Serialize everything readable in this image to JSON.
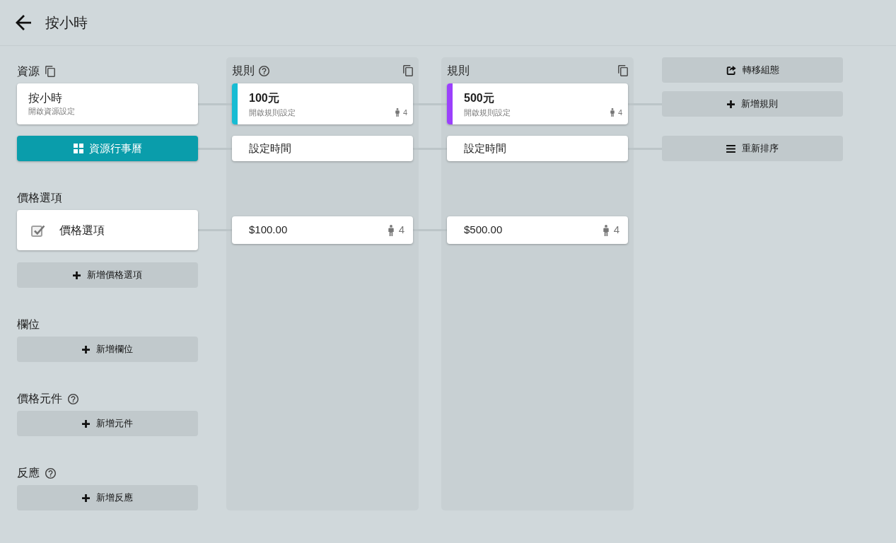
{
  "header": {
    "title": "按小時"
  },
  "resource": {
    "heading": "資源",
    "card": {
      "title": "按小時",
      "subtitle": "開啟資源設定"
    },
    "calendar_button": "資源行事曆"
  },
  "price_options": {
    "heading": "價格選項",
    "items": [
      {
        "label": "價格選項",
        "checked": true
      }
    ],
    "add_button": "新增價格選項"
  },
  "sections": [
    {
      "heading": "欄位",
      "help": false,
      "add_button": "新增欄位"
    },
    {
      "heading": "價格元件",
      "help": true,
      "add_button": "新增元件"
    },
    {
      "heading": "反應",
      "help": true,
      "add_button": "新增反應"
    }
  ],
  "rule_columns": [
    {
      "heading": "規則",
      "help": true,
      "color": "#18bcd3",
      "rule": {
        "title": "100元",
        "subtitle": "開啟規則設定",
        "count": "4"
      },
      "schedule": "設定時間",
      "price": {
        "amount": "$100.00",
        "count": "4"
      }
    },
    {
      "heading": "規則",
      "help": false,
      "color": "#9b40fc",
      "rule": {
        "title": "500元",
        "subtitle": "開啟規則設定",
        "count": "4"
      },
      "schedule": "設定時間",
      "price": {
        "amount": "$500.00",
        "count": "4"
      }
    }
  ],
  "actions": [
    {
      "kind": "transfer",
      "label": "轉移組態"
    },
    {
      "kind": "add",
      "label": "新增規則"
    },
    {
      "kind": "reorder",
      "label": "重新排序"
    }
  ]
}
